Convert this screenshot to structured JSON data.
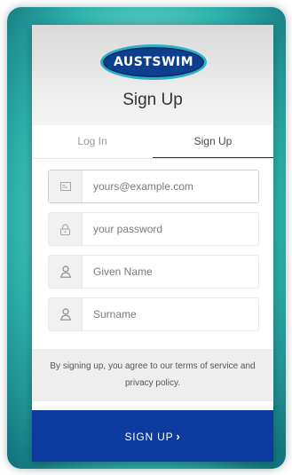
{
  "brand": {
    "logo_text": "AUSTSWIM"
  },
  "header": {
    "title": "Sign Up"
  },
  "tabs": [
    {
      "label": "Log In",
      "active": false
    },
    {
      "label": "Sign Up",
      "active": true
    }
  ],
  "form": {
    "email": {
      "placeholder": "yours@example.com",
      "icon": "envelope-icon"
    },
    "password": {
      "placeholder": "your password",
      "icon": "lock-icon"
    },
    "given_name": {
      "placeholder": "Given Name",
      "icon": "user-icon"
    },
    "surname": {
      "placeholder": "Surname",
      "icon": "user-icon"
    }
  },
  "terms": {
    "text": "By signing up, you agree to our terms of service and privacy policy."
  },
  "submit": {
    "label": "SIGN UP",
    "chevron": "›"
  },
  "colors": {
    "accent": "#0c3a9e",
    "logo_ring": "#2bb0c8"
  }
}
